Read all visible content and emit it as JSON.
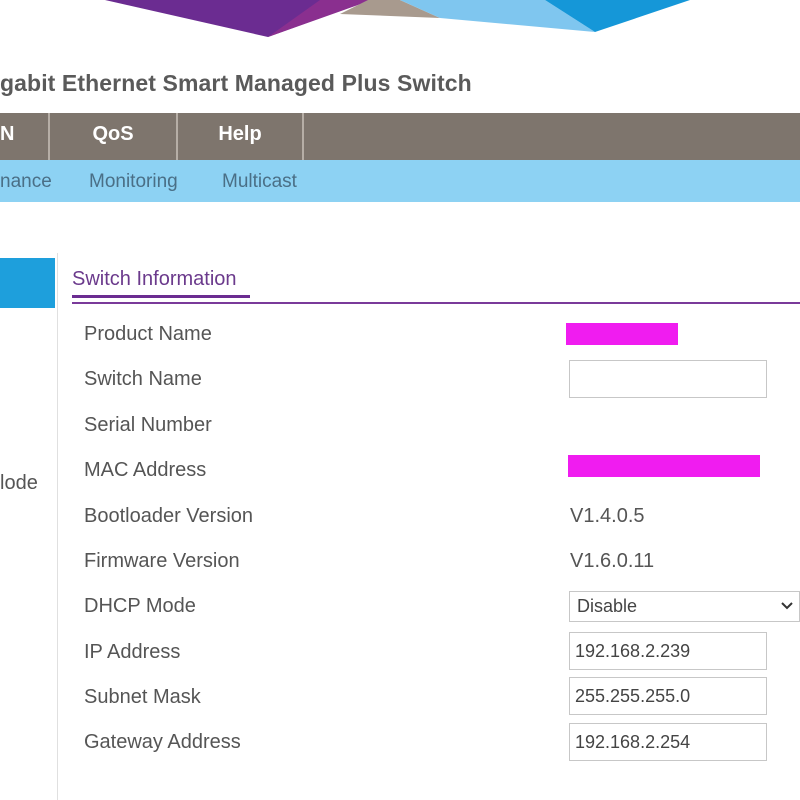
{
  "header": {
    "product_title": "gabit Ethernet Smart Managed Plus Switch"
  },
  "main_menu": {
    "items": [
      {
        "label": "N"
      },
      {
        "label": "QoS"
      },
      {
        "label": "Help"
      }
    ],
    "background": "#7e756d"
  },
  "sub_menu": {
    "items": [
      {
        "label": "nance"
      },
      {
        "label": "Monitoring"
      },
      {
        "label": "Multicast"
      }
    ],
    "background": "#8dd2f3"
  },
  "left_nav": {
    "items": [
      {
        "label": "lode"
      }
    ],
    "active_color": "#1e9fdc"
  },
  "section": {
    "title": "Switch Information",
    "accent": "#6b2c91"
  },
  "form": {
    "product_name_label": "Product Name",
    "switch_name_label": "Switch Name",
    "switch_name_value": "",
    "serial_number_label": "Serial Number",
    "mac_address_label": "MAC Address",
    "bootloader_version_label": "Bootloader Version",
    "bootloader_version_value": "V1.4.0.5",
    "firmware_version_label": "Firmware Version",
    "firmware_version_value": "V1.6.0.11",
    "dhcp_mode_label": "DHCP Mode",
    "dhcp_mode_value": "Disable",
    "ip_address_label": "IP Address",
    "ip_address_value": "192.168.2.239",
    "subnet_mask_label": "Subnet Mask",
    "subnet_mask_value": "255.255.255.0",
    "gateway_address_label": "Gateway Address",
    "gateway_address_value": "192.168.2.254",
    "redaction_color": "#f01cf0"
  },
  "icons": {
    "dropdown": "chevron-down-icon"
  }
}
